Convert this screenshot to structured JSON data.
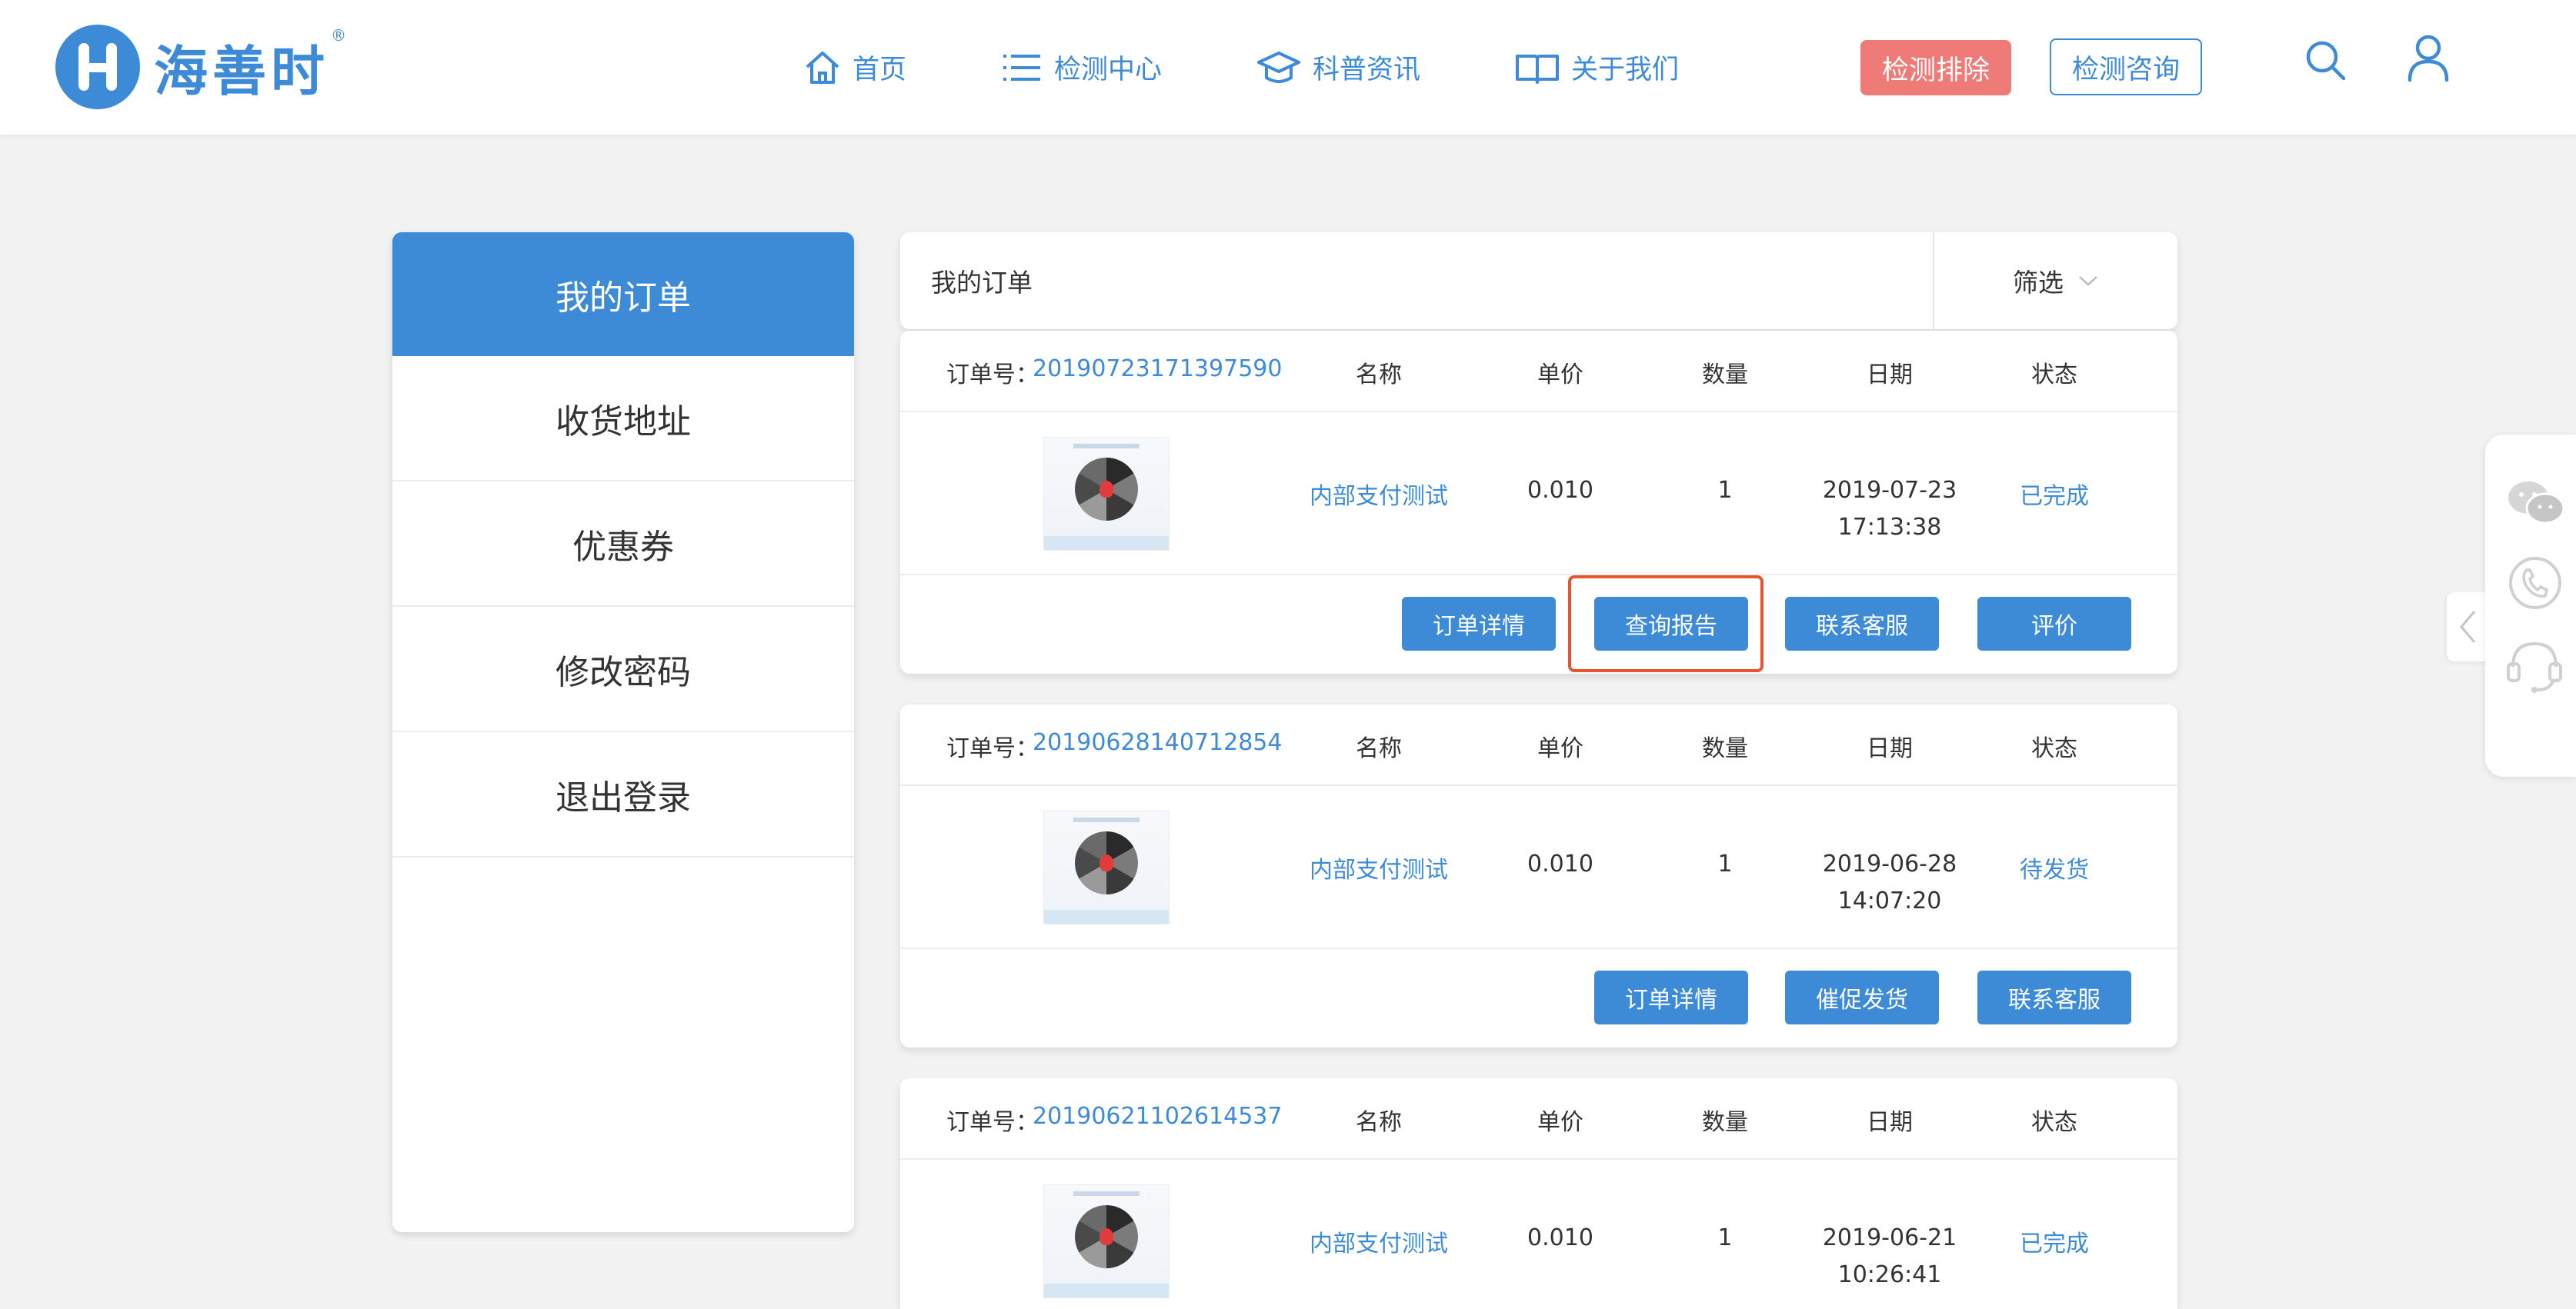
{
  "header": {
    "logo_text": "海善时",
    "logo_reg": "®",
    "nav": [
      {
        "label": "首页",
        "icon": "home-icon"
      },
      {
        "label": "检测中心",
        "icon": "list-icon"
      },
      {
        "label": "科普资讯",
        "icon": "graduation-cap-icon"
      },
      {
        "label": "关于我们",
        "icon": "book-icon"
      }
    ],
    "btn_primary": "检测排除",
    "btn_secondary": "检测咨询",
    "search_icon": "search-icon",
    "user_icon": "user-icon"
  },
  "sidebar": {
    "items": [
      {
        "label": "我的订单",
        "active": true
      },
      {
        "label": "收货地址"
      },
      {
        "label": "优惠券"
      },
      {
        "label": "修改密码"
      },
      {
        "label": "退出登录"
      }
    ]
  },
  "main": {
    "title": "我的订单",
    "filter": "筛选",
    "columns": {
      "name": "名称",
      "price": "单价",
      "qty": "数量",
      "date": "日期",
      "status": "状态"
    },
    "order_no_label": "订单号：",
    "orders": [
      {
        "order_no": "20190723171397590",
        "name": "内部支付测试",
        "price": "0.010",
        "qty": "1",
        "date": "2019-07-23",
        "time": "17:13:38",
        "status": "已完成",
        "actions": [
          "订单详情",
          "查询报告",
          "联系客服",
          "评价"
        ]
      },
      {
        "order_no": "20190628140712854",
        "name": "内部支付测试",
        "price": "0.010",
        "qty": "1",
        "date": "2019-06-28",
        "time": "14:07:20",
        "status": "待发货",
        "actions": [
          "订单详情",
          "催促发货",
          "联系客服"
        ]
      },
      {
        "order_no": "20190621102614537",
        "name": "内部支付测试",
        "price": "0.010",
        "qty": "1",
        "date": "2019-06-21",
        "time": "10:26:41",
        "status": "已完成",
        "actions": []
      }
    ]
  },
  "colors": {
    "brand": "#3d8bd6",
    "danger": "#ee7b78",
    "highlight": "#e8542f"
  },
  "float_icons": [
    "wechat-icon",
    "phone-icon",
    "customer-service-icon",
    "chevron-left-icon"
  ]
}
